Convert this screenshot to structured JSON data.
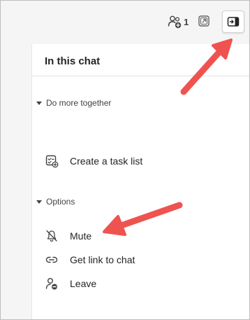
{
  "header": {
    "participants_count": "1",
    "icons": {
      "participants": "people-add-icon",
      "popout": "open-in-window-icon",
      "side_panel": "panel-toggle-icon"
    }
  },
  "panel": {
    "title": "In this chat",
    "sections": [
      {
        "label": "Do more together",
        "items": [
          {
            "label": "Create a task list",
            "icon": "task-list-icon"
          }
        ]
      },
      {
        "label": "Options",
        "items": [
          {
            "label": "Mute",
            "icon": "bell-off-icon"
          },
          {
            "label": "Get link to chat",
            "icon": "link-icon"
          },
          {
            "label": "Leave",
            "icon": "person-leave-icon"
          }
        ]
      }
    ]
  },
  "colors": {
    "annotation_arrow": "#ef5350",
    "panel_background": "#ffffff",
    "chrome_background": "#f5f5f5"
  }
}
